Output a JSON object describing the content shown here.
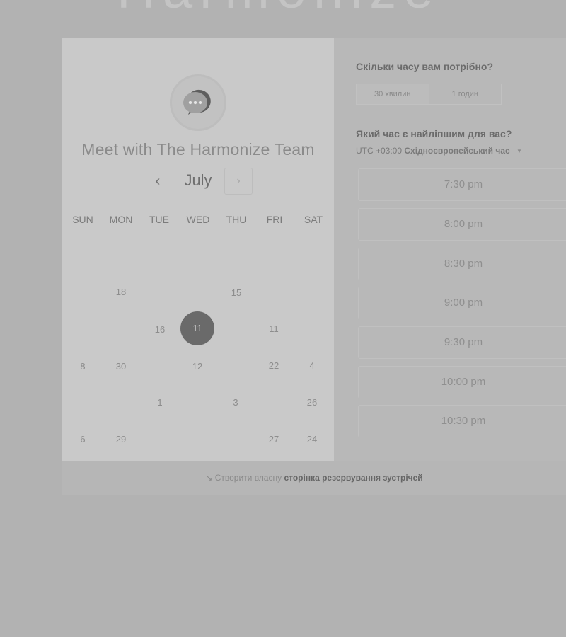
{
  "brand": {
    "logo_text": "Harmonize"
  },
  "calendar": {
    "title": "Meet with The Harmonize Team",
    "month": "July",
    "prev_icon": "‹",
    "next_icon": "›",
    "weekdays": [
      "SUN",
      "MON",
      "TUE",
      "WED",
      "THU",
      "FRI",
      "SAT"
    ],
    "days": {
      "r1": [
        "18",
        "15"
      ],
      "r2": [
        "16",
        "11"
      ],
      "r3": [
        "8",
        "30",
        "12",
        "22",
        "4"
      ],
      "r4": [
        "1",
        "3",
        "26"
      ],
      "r5": [
        "6",
        "29",
        "27",
        "24"
      ]
    },
    "selected_day": "11"
  },
  "duration": {
    "question": "Скільки часу вам потрібно?",
    "options": [
      "30 хвилин",
      "1 годин"
    ],
    "selected": "30 хвилин"
  },
  "time": {
    "question": "Який час є найліпшим для вас?",
    "timezone_offset": "UTC +03:00",
    "timezone_name": "Східноєвропейський час",
    "slots": [
      "7:30 pm",
      "8:00 pm",
      "8:30 pm",
      "9:00 pm",
      "9:30 pm",
      "10:00 pm",
      "10:30 pm"
    ]
  },
  "footer": {
    "prefix": "Створити власну",
    "link": "сторінка резервування зустрічей"
  },
  "colors": {
    "background": "#b2b2b2",
    "panel": "#c9c9c9",
    "selected_day": "#6a6a6a"
  }
}
